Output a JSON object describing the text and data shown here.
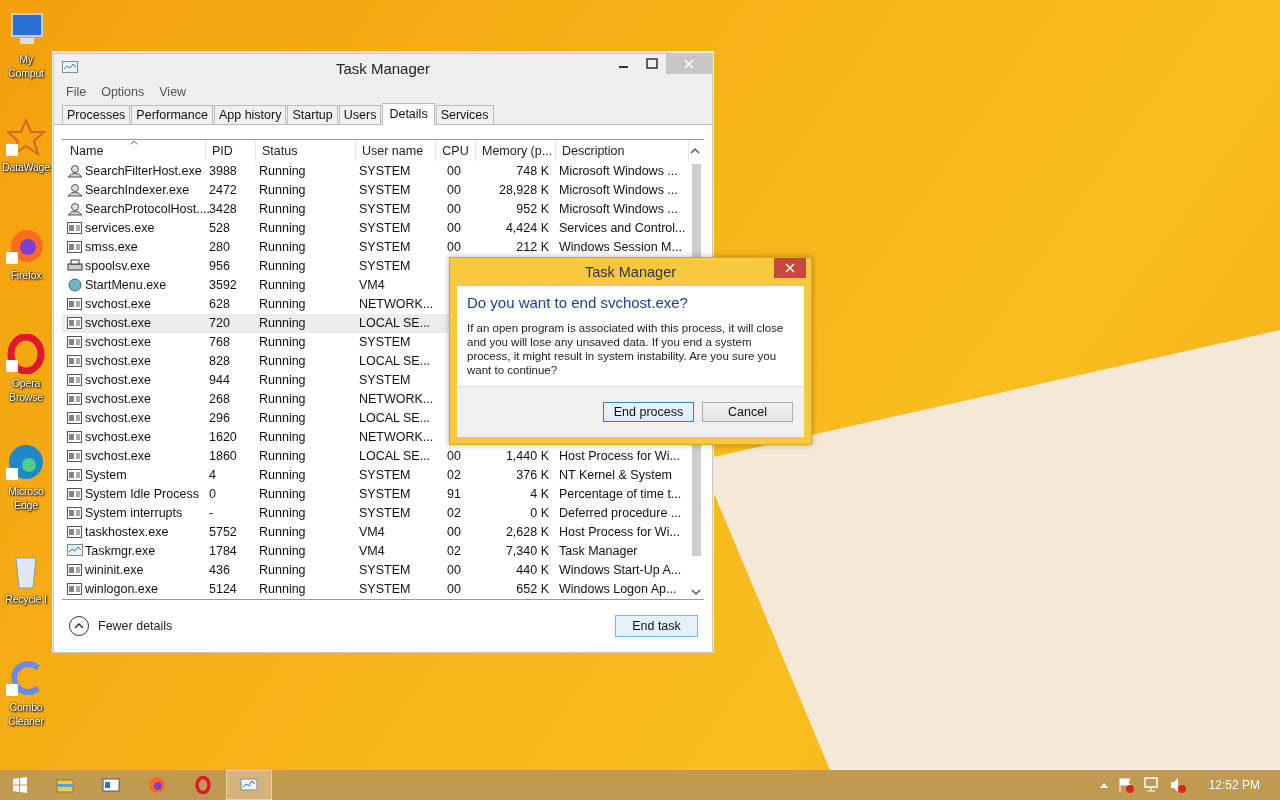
{
  "desktop_icons": [
    {
      "kind": "computer",
      "lines": [
        "My",
        "Comput"
      ]
    },
    {
      "kind": "star",
      "lines": [
        "DataWage"
      ]
    },
    {
      "kind": "firefox",
      "lines": [
        "Firefox"
      ]
    },
    {
      "kind": "opera",
      "lines": [
        "Opera",
        "Browse"
      ]
    },
    {
      "kind": "edge",
      "lines": [
        "Microso",
        "Edge"
      ]
    },
    {
      "kind": "recycle",
      "lines": [
        "Recycle I"
      ]
    },
    {
      "kind": "combo",
      "lines": [
        "Combo",
        "Cleaner"
      ]
    }
  ],
  "window": {
    "title": "Task Manager",
    "menu": [
      "File",
      "Options",
      "View"
    ],
    "tabs": [
      {
        "label": "Processes",
        "selected": false
      },
      {
        "label": "Performance",
        "selected": false
      },
      {
        "label": "App history",
        "selected": false
      },
      {
        "label": "Startup",
        "selected": false
      },
      {
        "label": "Users",
        "selected": false
      },
      {
        "label": "Details",
        "selected": true
      },
      {
        "label": "Services",
        "selected": false
      }
    ],
    "table": {
      "columns": [
        {
          "label": "Name",
          "sorted": true
        },
        {
          "label": "PID",
          "sorted": false
        },
        {
          "label": "Status",
          "sorted": false
        },
        {
          "label": "User name",
          "sorted": false
        },
        {
          "label": "CPU",
          "sorted": false
        },
        {
          "label": "Memory (p...",
          "sorted": false
        },
        {
          "label": "Description",
          "sorted": false
        }
      ],
      "rows": [
        {
          "kind": "search",
          "selected": false,
          "cells": [
            "SearchFilterHost.exe",
            "3988",
            "Running",
            "SYSTEM",
            "00",
            "748 K",
            "Microsoft Windows ..."
          ]
        },
        {
          "kind": "search",
          "selected": false,
          "cells": [
            "SearchIndexer.exe",
            "2472",
            "Running",
            "SYSTEM",
            "00",
            "28,928 K",
            "Microsoft Windows ..."
          ]
        },
        {
          "kind": "search",
          "selected": false,
          "cells": [
            "SearchProtocolHost....",
            "3428",
            "Running",
            "SYSTEM",
            "00",
            "952 K",
            "Microsoft Windows ..."
          ]
        },
        {
          "kind": "window",
          "selected": false,
          "cells": [
            "services.exe",
            "528",
            "Running",
            "SYSTEM",
            "00",
            "4,424 K",
            "Services and Control..."
          ]
        },
        {
          "kind": "window",
          "selected": false,
          "cells": [
            "smss.exe",
            "280",
            "Running",
            "SYSTEM",
            "00",
            "212 K",
            "Windows Session M..."
          ]
        },
        {
          "kind": "printer",
          "selected": false,
          "cells": [
            "spoolsv.exe",
            "956",
            "Running",
            "SYSTEM"
          ]
        },
        {
          "kind": "globe",
          "selected": false,
          "cells": [
            "StartMenu.exe",
            "3592",
            "Running",
            "VM4"
          ]
        },
        {
          "kind": "window",
          "selected": false,
          "cells": [
            "svchost.exe",
            "628",
            "Running",
            "NETWORK..."
          ]
        },
        {
          "kind": "window",
          "selected": true,
          "cells": [
            "svchost.exe",
            "720",
            "Running",
            "LOCAL SE..."
          ]
        },
        {
          "kind": "window",
          "selected": false,
          "cells": [
            "svchost.exe",
            "768",
            "Running",
            "SYSTEM"
          ]
        },
        {
          "kind": "window",
          "selected": false,
          "cells": [
            "svchost.exe",
            "828",
            "Running",
            "LOCAL SE..."
          ]
        },
        {
          "kind": "window",
          "selected": false,
          "cells": [
            "svchost.exe",
            "944",
            "Running",
            "SYSTEM"
          ]
        },
        {
          "kind": "window",
          "selected": false,
          "cells": [
            "svchost.exe",
            "268",
            "Running",
            "NETWORK..."
          ]
        },
        {
          "kind": "window",
          "selected": false,
          "cells": [
            "svchost.exe",
            "296",
            "Running",
            "LOCAL SE..."
          ]
        },
        {
          "kind": "window",
          "selected": false,
          "cells": [
            "svchost.exe",
            "1620",
            "Running",
            "NETWORK..."
          ]
        },
        {
          "kind": "window",
          "selected": false,
          "cells": [
            "svchost.exe",
            "1860",
            "Running",
            "LOCAL SE...",
            "00",
            "1,440 K",
            "Host Process for Wi..."
          ]
        },
        {
          "kind": "window",
          "selected": false,
          "cells": [
            "System",
            "4",
            "Running",
            "SYSTEM",
            "02",
            "376 K",
            "NT Kernel & System"
          ]
        },
        {
          "kind": "window",
          "selected": false,
          "cells": [
            "System Idle Process",
            "0",
            "Running",
            "SYSTEM",
            "91",
            "4 K",
            "Percentage of time t..."
          ]
        },
        {
          "kind": "window",
          "selected": false,
          "cells": [
            "System interrupts",
            "-",
            "Running",
            "SYSTEM",
            "02",
            "0 K",
            "Deferred procedure ..."
          ]
        },
        {
          "kind": "window",
          "selected": false,
          "cells": [
            "taskhostex.exe",
            "5752",
            "Running",
            "VM4",
            "00",
            "2,628 K",
            "Host Process for Wi..."
          ]
        },
        {
          "kind": "taskmgr",
          "selected": false,
          "cells": [
            "Taskmgr.exe",
            "1784",
            "Running",
            "VM4",
            "02",
            "7,340 K",
            "Task Manager"
          ]
        },
        {
          "kind": "window",
          "selected": false,
          "cells": [
            "wininit.exe",
            "436",
            "Running",
            "SYSTEM",
            "00",
            "440 K",
            "Windows Start-Up A..."
          ]
        },
        {
          "kind": "window",
          "selected": false,
          "cells": [
            "winlogon.exe",
            "5124",
            "Running",
            "SYSTEM",
            "00",
            "652 K",
            "Windows Logon Ap..."
          ]
        }
      ]
    },
    "fewer_details": "Fewer details",
    "end_task": "End task"
  },
  "dialog": {
    "title": "Task Manager",
    "question": "Do you want to end svchost.exe?",
    "message": "If an open program is associated with this process, it will close and you will lose any unsaved data. If you end a system process, it might result in system instability. Are you sure you want to continue?",
    "buttons": [
      {
        "label": "End process",
        "default": true
      },
      {
        "label": "Cancel",
        "default": false
      }
    ]
  },
  "taskbar": {
    "items": [
      {
        "kind": "explorer",
        "selected": false
      },
      {
        "kind": "app",
        "selected": false
      },
      {
        "kind": "firefox",
        "selected": false
      },
      {
        "kind": "opera",
        "selected": false
      },
      {
        "kind": "taskmgr",
        "selected": true
      }
    ],
    "time": "12:52 PM"
  }
}
